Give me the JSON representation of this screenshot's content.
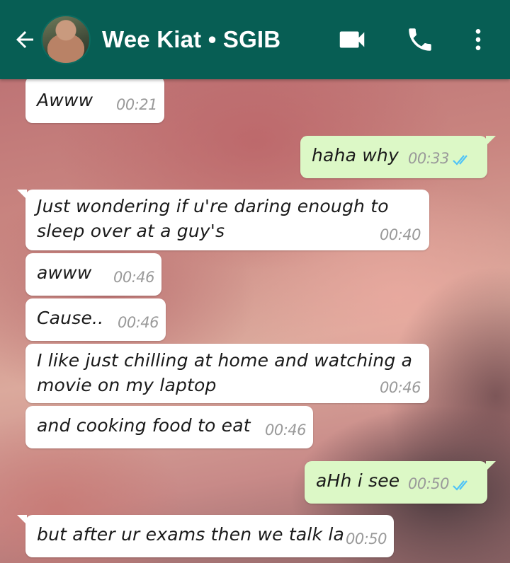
{
  "header": {
    "title": "Wee Kiat • SGIB",
    "back_icon": "arrow-left-icon",
    "video_icon": "videocam-icon",
    "call_icon": "phone-icon",
    "menu_icon": "more-vert-icon",
    "color": "#075e54"
  },
  "colors": {
    "incoming_bubble": "#ffffff",
    "outgoing_bubble": "#dcf8c6",
    "read_ticks": "#4fc3f7"
  },
  "messages": [
    {
      "direction": "in",
      "lines": [
        "Awww"
      ],
      "time": "00:21"
    },
    {
      "direction": "out",
      "lines": [
        "haha why"
      ],
      "time": "00:33",
      "status": "read"
    },
    {
      "direction": "in",
      "lines": [
        "Just wondering if u're daring enough to",
        "sleep over at a guy's"
      ],
      "time": "00:40"
    },
    {
      "direction": "in",
      "lines": [
        "awww"
      ],
      "time": "00:46"
    },
    {
      "direction": "in",
      "lines": [
        "Cause.."
      ],
      "time": "00:46"
    },
    {
      "direction": "in",
      "lines": [
        "I like just chilling at home and watching a",
        "movie on my laptop"
      ],
      "time": "00:46"
    },
    {
      "direction": "in",
      "lines": [
        "and cooking food to eat"
      ],
      "time": "00:46"
    },
    {
      "direction": "out",
      "lines": [
        "aHh i see"
      ],
      "time": "00:50",
      "status": "read"
    },
    {
      "direction": "in",
      "lines": [
        "but after ur exams then we talk la"
      ],
      "time": "00:50"
    }
  ]
}
